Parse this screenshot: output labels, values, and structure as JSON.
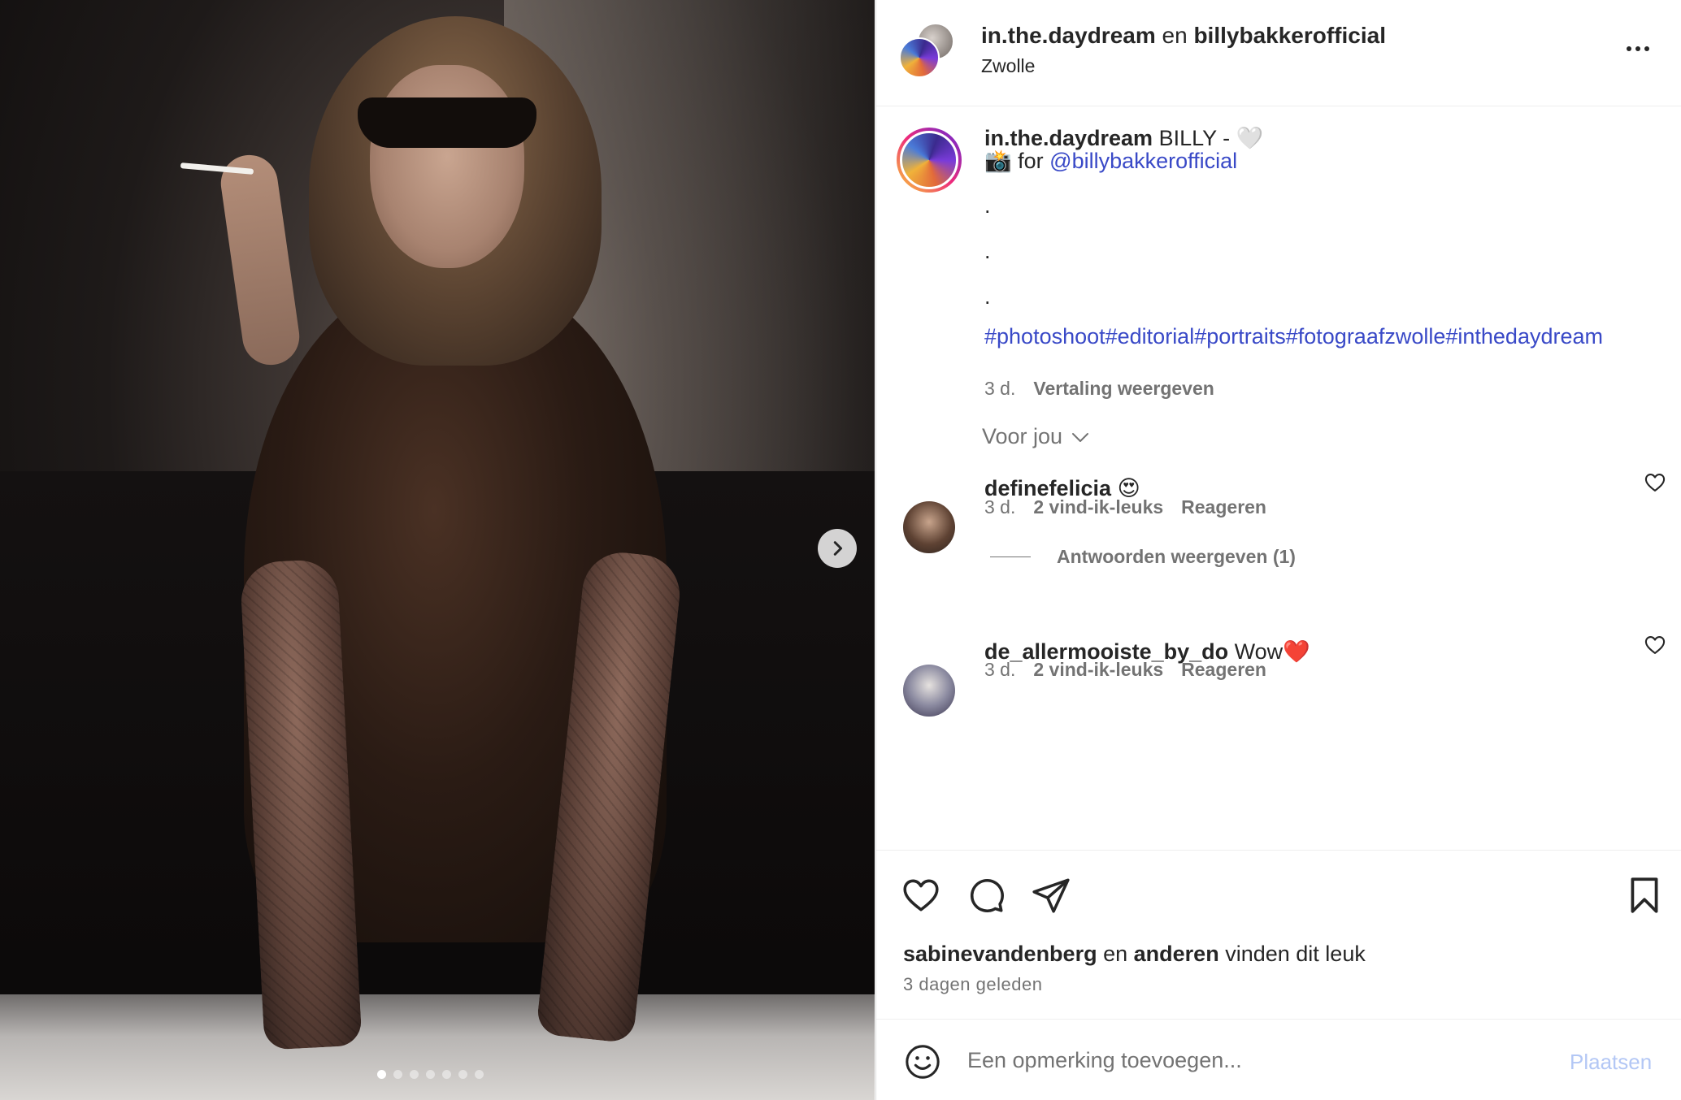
{
  "header": {
    "account1": "in.the.daydream",
    "joiner": "en",
    "account2": "billybakkerofficial",
    "location": "Zwolle"
  },
  "caption": {
    "username": "in.the.daydream",
    "text": "BILLY - 🤍",
    "line2_prefix": "📸 for",
    "mention": "@billybakkerofficial",
    "dot": ".",
    "hashtags": "#photoshoot#editorial#portraits#fotograafzwolle#inthedaydream",
    "age": "3 d.",
    "translate": "Vertaling weergeven"
  },
  "voor_jou": "Voor jou",
  "comments": [
    {
      "username": "definefelicia",
      "text": "😍",
      "age": "3 d.",
      "likes": "2 vind-ik-leuks",
      "reply": "Reageren",
      "view_replies": "Antwoorden weergeven (1)"
    },
    {
      "username": "de_allermooiste_by_do",
      "text": "Wow❤️",
      "age": "3 d.",
      "likes": "2 vind-ik-leuks",
      "reply": "Reageren"
    }
  ],
  "likes": {
    "user": "sabinevandenberg",
    "joiner": "en",
    "others": "anderen",
    "suffix": "vinden dit leuk"
  },
  "posted": "3 dagen geleden",
  "composer": {
    "placeholder": "Een opmerking toevoegen...",
    "post": "Plaatsen"
  },
  "carousel": {
    "total": 7,
    "active": 1
  },
  "colors": {
    "link": "#3949c7",
    "muted": "#737373",
    "post_disabled": "#b3c7f5"
  }
}
